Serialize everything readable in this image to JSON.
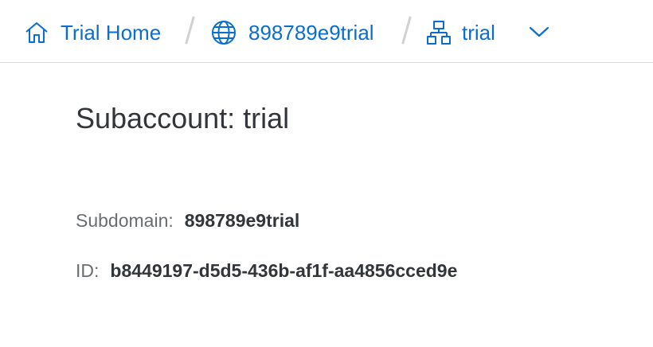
{
  "breadcrumb": {
    "items": [
      {
        "label": "Trial Home",
        "icon": "home-icon"
      },
      {
        "label": "898789e9trial",
        "icon": "globe-icon"
      },
      {
        "label": "trial",
        "icon": "hierarchy-icon"
      }
    ],
    "dropdown_icon": "chevron-down-icon"
  },
  "page": {
    "title": "Subaccount: trial"
  },
  "details": {
    "subdomain_label": "Subdomain:",
    "subdomain_value": "898789e9trial",
    "id_label": "ID:",
    "id_value": "b8449197-d5d5-436b-af1f-aa4856cced9e"
  },
  "colors": {
    "link": "#0a6ed1",
    "text": "#32363a",
    "label": "#6a6d70",
    "separator": "#d1d1d1",
    "border": "#d9d9d9"
  }
}
